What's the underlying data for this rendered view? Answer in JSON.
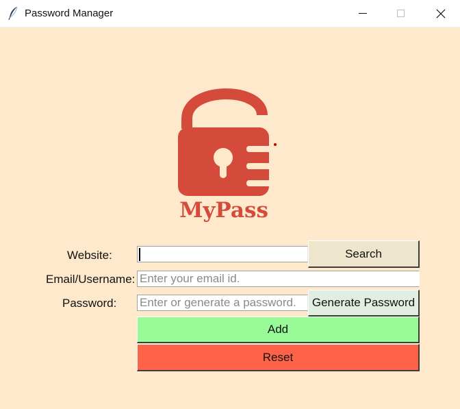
{
  "window": {
    "title": "Password Manager",
    "app_icon": "feather-icon",
    "controls": [
      "minimize-icon",
      "maximize-icon",
      "close-icon"
    ]
  },
  "logo": {
    "text": "MyPass",
    "icon": "open-padlock-icon",
    "color": "#d44b3c"
  },
  "form": {
    "website": {
      "label": "Website:",
      "value": "",
      "placeholder": ""
    },
    "email": {
      "label": "Email/Username:",
      "value": "",
      "placeholder": "Enter your email id."
    },
    "password": {
      "label": "Password:",
      "value": "",
      "placeholder": "Enter or generate a password."
    }
  },
  "buttons": {
    "search": "Search",
    "generate": "Generate Password",
    "add": "Add",
    "reset": "Reset"
  },
  "colors": {
    "background": "#ffe9cc",
    "search_button": "#ede6cc",
    "generate_button": "#e3eee3",
    "add_button": "#98fb98",
    "reset_button": "#ff6347"
  }
}
